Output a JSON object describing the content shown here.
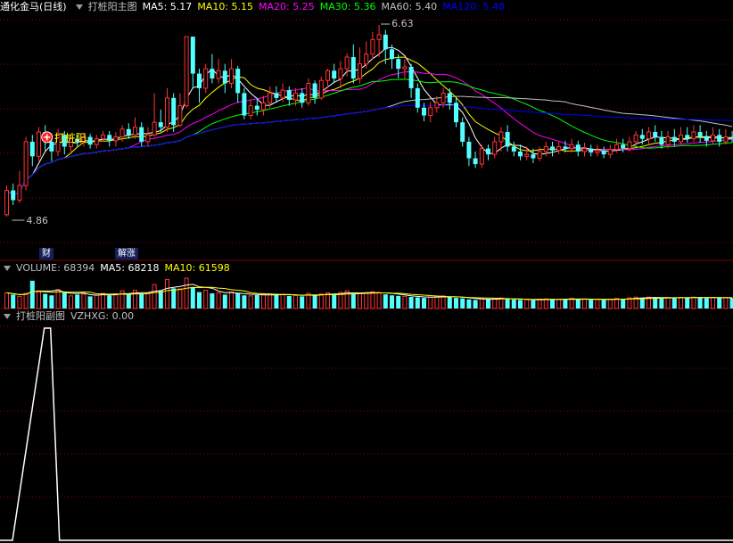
{
  "main_panel": {
    "stock_title": "通化金马(日线)",
    "indicator_name": "打桩阳主图",
    "ma_items": [
      {
        "label": "MA5: 5.17",
        "color": "#ffffff"
      },
      {
        "label": "MA10: 5.15",
        "color": "#ffff00"
      },
      {
        "label": "MA20: 5.25",
        "color": "#ff00ff"
      },
      {
        "label": "MA30: 5.36",
        "color": "#00ff00"
      },
      {
        "label": "MA60: 5.40",
        "color": "#c0c0c0"
      },
      {
        "label": "MA120: 5.48",
        "color": "#0000ff"
      }
    ],
    "high_label": "6.63",
    "low_label": "4.86",
    "signal_text": "打桩阳",
    "tag_left": "财",
    "tag_right": "解涨"
  },
  "volume_panel": {
    "title": "VOLUME: 68394",
    "ma5": "MA5: 68218",
    "ma10": "MA10: 61598"
  },
  "sub_panel": {
    "title": "打桩阳副图",
    "value_label": "VZHXG: 0.00"
  },
  "colors": {
    "up": "#ff3333",
    "down": "#54ffff",
    "ma5": "#ffffff",
    "ma10": "#ffff00",
    "ma20": "#ff00ff",
    "ma30": "#00ff00",
    "ma60": "#c0c0c0",
    "ma120": "#0000ff",
    "grid": "#8b0000",
    "separator": "#7a0000"
  },
  "chart_data": {
    "type": "candlestick",
    "price_range": [
      4.86,
      6.63
    ],
    "candles": [
      [
        4.8,
        5.05,
        5.1,
        4.78
      ],
      [
        5.05,
        4.95,
        5.12,
        4.9
      ],
      [
        4.95,
        5.1,
        5.25,
        4.92
      ],
      [
        5.1,
        5.55,
        5.6,
        5.05
      ],
      [
        5.55,
        5.4,
        5.62,
        5.3
      ],
      [
        5.4,
        5.65,
        5.7,
        5.35
      ],
      [
        5.65,
        5.55,
        5.72,
        5.45
      ],
      [
        5.55,
        5.45,
        5.6,
        5.35
      ],
      [
        5.45,
        5.62,
        5.68,
        5.4
      ],
      [
        5.62,
        5.5,
        5.66,
        5.42
      ],
      [
        5.5,
        5.58,
        5.62,
        5.45
      ],
      [
        5.58,
        5.55,
        5.62,
        5.5
      ],
      [
        5.55,
        5.6,
        5.64,
        5.5
      ],
      [
        5.6,
        5.52,
        5.63,
        5.48
      ],
      [
        5.52,
        5.58,
        5.62,
        5.48
      ],
      [
        5.58,
        5.62,
        5.66,
        5.55
      ],
      [
        5.62,
        5.56,
        5.66,
        5.5
      ],
      [
        5.56,
        5.6,
        5.65,
        5.5
      ],
      [
        5.6,
        5.68,
        5.72,
        5.55
      ],
      [
        5.68,
        5.62,
        5.74,
        5.58
      ],
      [
        5.62,
        5.7,
        5.8,
        5.58
      ],
      [
        5.7,
        5.55,
        5.75,
        5.5
      ],
      [
        5.55,
        5.62,
        5.7,
        5.5
      ],
      [
        5.62,
        5.75,
        6.05,
        5.6
      ],
      [
        5.75,
        5.7,
        5.88,
        5.65
      ],
      [
        5.7,
        6.0,
        6.1,
        5.65
      ],
      [
        6.0,
        5.72,
        6.05,
        5.65
      ],
      [
        5.72,
        5.92,
        6.05,
        5.7
      ],
      [
        5.92,
        6.63,
        6.63,
        5.9
      ],
      [
        6.63,
        6.25,
        6.63,
        6.1
      ],
      [
        6.25,
        6.1,
        6.3,
        5.95
      ],
      [
        6.1,
        6.3,
        6.35,
        6.05
      ],
      [
        6.3,
        6.2,
        6.45,
        6.15
      ],
      [
        6.2,
        6.28,
        6.4,
        6.15
      ],
      [
        6.28,
        6.15,
        6.35,
        6.05
      ],
      [
        6.15,
        6.3,
        6.4,
        6.1
      ],
      [
        6.3,
        6.05,
        6.33,
        5.95
      ],
      [
        6.05,
        5.82,
        6.1,
        5.78
      ],
      [
        5.82,
        5.92,
        5.98,
        5.78
      ],
      [
        5.92,
        5.88,
        6.0,
        5.82
      ],
      [
        5.88,
        5.95,
        6.02,
        5.82
      ],
      [
        5.95,
        6.05,
        6.12,
        5.9
      ],
      [
        6.05,
        6.0,
        6.12,
        5.95
      ],
      [
        6.0,
        6.08,
        6.15,
        5.96
      ],
      [
        6.08,
        5.98,
        6.12,
        5.92
      ],
      [
        5.98,
        6.05,
        6.1,
        5.92
      ],
      [
        6.05,
        5.95,
        6.1,
        5.9
      ],
      [
        5.95,
        6.15,
        6.2,
        5.92
      ],
      [
        6.15,
        6.0,
        6.18,
        5.94
      ],
      [
        6.0,
        6.18,
        6.22,
        5.98
      ],
      [
        6.18,
        6.28,
        6.3,
        6.1
      ],
      [
        6.28,
        6.2,
        6.35,
        6.15
      ],
      [
        6.2,
        6.3,
        6.38,
        6.1
      ],
      [
        6.3,
        6.42,
        6.46,
        6.22
      ],
      [
        6.42,
        6.2,
        6.55,
        6.15
      ],
      [
        6.2,
        6.35,
        6.52,
        6.15
      ],
      [
        6.35,
        6.45,
        6.58,
        6.3
      ],
      [
        6.45,
        6.6,
        6.68,
        6.4
      ],
      [
        6.6,
        6.65,
        6.75,
        6.42
      ],
      [
        6.65,
        6.5,
        6.7,
        6.35
      ],
      [
        6.5,
        6.4,
        6.55,
        6.3
      ],
      [
        6.4,
        6.3,
        6.45,
        6.2
      ],
      [
        6.3,
        6.32,
        6.4,
        6.2
      ],
      [
        6.32,
        6.1,
        6.35,
        6.0
      ],
      [
        6.1,
        5.9,
        6.15,
        5.85
      ],
      [
        5.9,
        5.82,
        5.95,
        5.76
      ],
      [
        5.82,
        5.9,
        5.96,
        5.75
      ],
      [
        5.9,
        5.95,
        6.02,
        5.85
      ],
      [
        5.95,
        6.05,
        6.1,
        5.9
      ],
      [
        6.05,
        5.95,
        6.1,
        5.88
      ],
      [
        5.95,
        5.75,
        6.0,
        5.7
      ],
      [
        5.75,
        5.55,
        5.8,
        5.5
      ],
      [
        5.55,
        5.38,
        5.6,
        5.3
      ],
      [
        5.38,
        5.32,
        5.45,
        5.28
      ],
      [
        5.32,
        5.48,
        5.52,
        5.28
      ],
      [
        5.48,
        5.42,
        5.52,
        5.36
      ],
      [
        5.42,
        5.55,
        5.6,
        5.38
      ],
      [
        5.55,
        5.65,
        5.7,
        5.45
      ],
      [
        5.65,
        5.5,
        5.72,
        5.45
      ],
      [
        5.5,
        5.45,
        5.55,
        5.4
      ],
      [
        5.45,
        5.4,
        5.52,
        5.36
      ],
      [
        5.4,
        5.42,
        5.5,
        5.36
      ],
      [
        5.42,
        5.38,
        5.48,
        5.33
      ],
      [
        5.38,
        5.45,
        5.5,
        5.35
      ],
      [
        5.45,
        5.5,
        5.55,
        5.4
      ],
      [
        5.5,
        5.46,
        5.55,
        5.4
      ],
      [
        5.46,
        5.5,
        5.55,
        5.42
      ],
      [
        5.5,
        5.48,
        5.56,
        5.44
      ],
      [
        5.48,
        5.52,
        5.58,
        5.44
      ],
      [
        5.52,
        5.45,
        5.56,
        5.4
      ],
      [
        5.45,
        5.48,
        5.54,
        5.4
      ],
      [
        5.48,
        5.44,
        5.52,
        5.4
      ],
      [
        5.44,
        5.46,
        5.52,
        5.4
      ],
      [
        5.46,
        5.42,
        5.5,
        5.38
      ],
      [
        5.42,
        5.47,
        5.52,
        5.38
      ],
      [
        5.47,
        5.52,
        5.58,
        5.44
      ],
      [
        5.52,
        5.48,
        5.58,
        5.44
      ],
      [
        5.48,
        5.55,
        5.6,
        5.45
      ],
      [
        5.55,
        5.62,
        5.66,
        5.5
      ],
      [
        5.62,
        5.58,
        5.68,
        5.52
      ],
      [
        5.58,
        5.65,
        5.7,
        5.52
      ],
      [
        5.65,
        5.6,
        5.72,
        5.55
      ],
      [
        5.6,
        5.52,
        5.66,
        5.48
      ],
      [
        5.52,
        5.6,
        5.66,
        5.48
      ],
      [
        5.6,
        5.55,
        5.68,
        5.5
      ],
      [
        5.55,
        5.62,
        5.7,
        5.52
      ],
      [
        5.62,
        5.58,
        5.7,
        5.54
      ],
      [
        5.58,
        5.65,
        5.72,
        5.55
      ],
      [
        5.65,
        5.6,
        5.72,
        5.54
      ],
      [
        5.6,
        5.56,
        5.66,
        5.5
      ],
      [
        5.56,
        5.62,
        5.7,
        5.52
      ],
      [
        5.62,
        5.55,
        5.68,
        5.5
      ],
      [
        5.55,
        5.6,
        5.68,
        5.52
      ],
      [
        5.6,
        5.58,
        5.66,
        5.54
      ]
    ],
    "volume": [
      62,
      55,
      48,
      60,
      110,
      70,
      58,
      52,
      75,
      66,
      50,
      55,
      57,
      48,
      53,
      60,
      52,
      58,
      70,
      55,
      72,
      58,
      60,
      95,
      70,
      115,
      80,
      78,
      120,
      85,
      65,
      72,
      60,
      62,
      55,
      66,
      60,
      52,
      50,
      53,
      55,
      58,
      54,
      56,
      50,
      52,
      48,
      60,
      52,
      58,
      62,
      55,
      64,
      70,
      58,
      60,
      62,
      66,
      64,
      56,
      52,
      50,
      48,
      46,
      44,
      42,
      45,
      48,
      50,
      46,
      42,
      40,
      36,
      34,
      38,
      36,
      40,
      42,
      38,
      35,
      34,
      35,
      33,
      36,
      38,
      36,
      37,
      38,
      40,
      36,
      37,
      35,
      36,
      34,
      37,
      40,
      38,
      42,
      45,
      43,
      45,
      44,
      40,
      43,
      42,
      44,
      43,
      45,
      44,
      41,
      44,
      42,
      43,
      41
    ],
    "vzhxg": {
      "peak_index": 6,
      "peak_value": 1,
      "current": 0.0
    }
  }
}
